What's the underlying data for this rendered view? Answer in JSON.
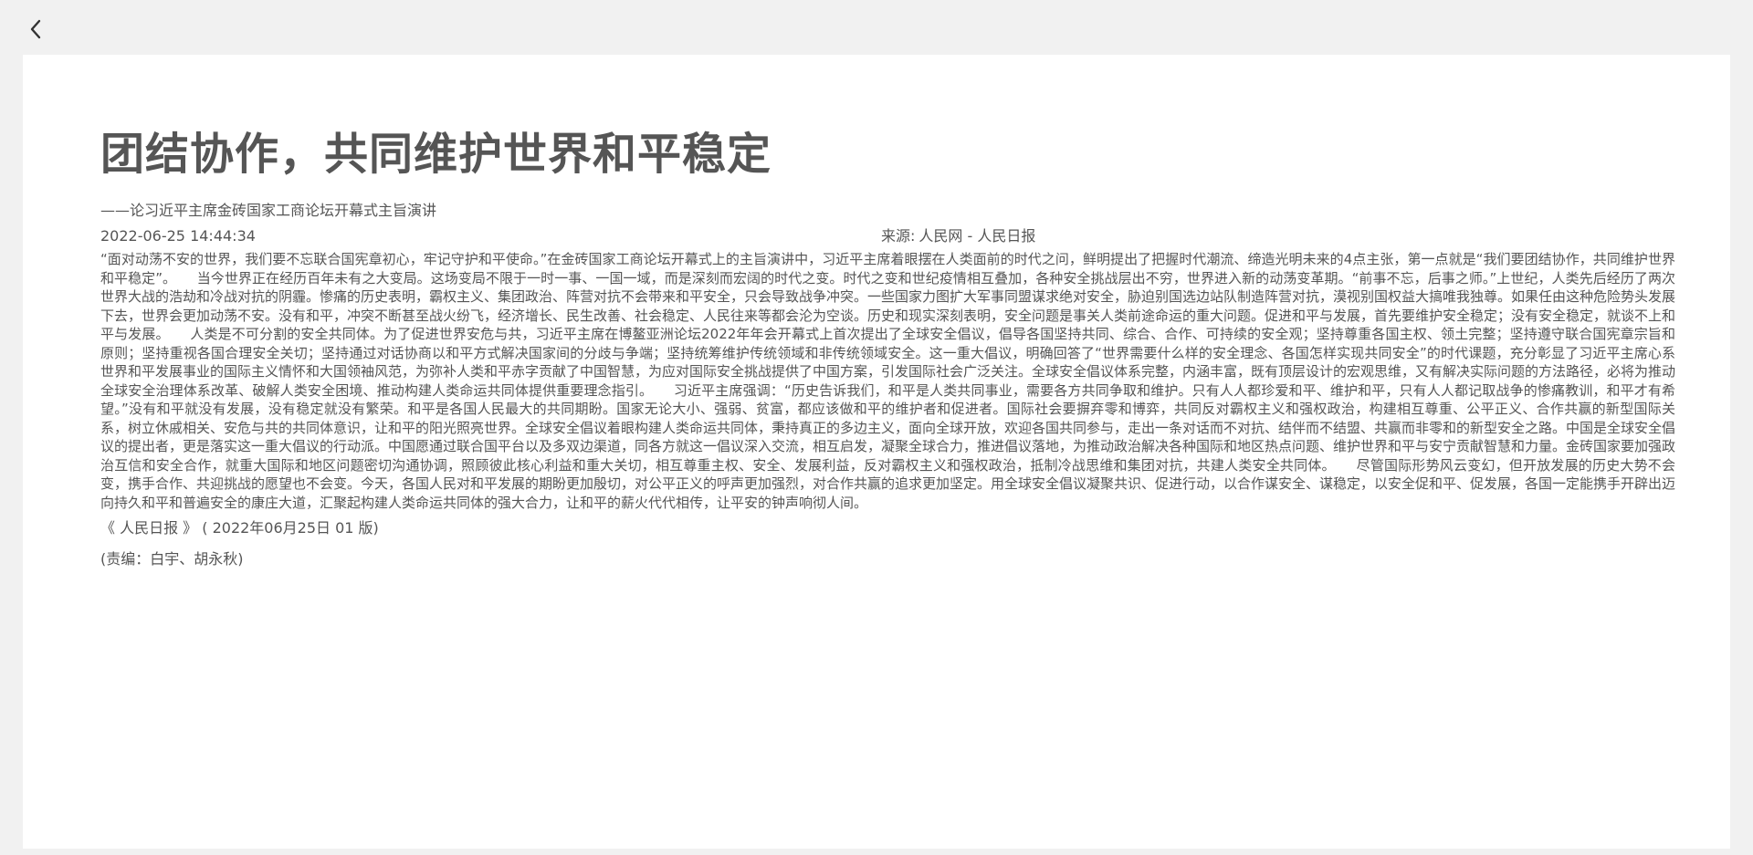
{
  "nav": {
    "back_icon": "chevron-left-icon"
  },
  "article": {
    "title": "团结协作，共同维护世界和平稳定",
    "subtitle": "——论习近平主席金砖国家工商论坛开幕式主旨演讲",
    "datetime": "2022-06-25 14:44:34",
    "source_label": "来源:",
    "source_value": "人民网 - 人民日报",
    "body": "“面对动荡不安的世界，我们要不忘联合国宪章初心，牢记守护和平使命。”在金砖国家工商论坛开幕式上的主旨演讲中，习近平主席着眼摆在人类面前的时代之问，鲜明提出了把握时代潮流、缔造光明未来的4点主张，第一点就是“我们要团结协作，共同维护世界和平稳定”。　　当今世界正在经历百年未有之大变局。这场变局不限于一时一事、一国一域，而是深刻而宏阔的时代之变。时代之变和世纪疫情相互叠加，各种安全挑战层出不穷，世界进入新的动荡变革期。“前事不忘，后事之师。”上世纪，人类先后经历了两次世界大战的浩劫和冷战对抗的阴霾。惨痛的历史表明，霸权主义、集团政治、阵营对抗不会带来和平安全，只会导致战争冲突。一些国家力图扩大军事同盟谋求绝对安全，胁迫别国选边站队制造阵营对抗，漠视别国权益大搞唯我独尊。如果任由这种危险势头发展下去，世界会更加动荡不安。没有和平，冲突不断甚至战火纷飞，经济增长、民生改善、社会稳定、人民往来等都会沦为空谈。历史和现实深刻表明，安全问题是事关人类前途命运的重大问题。促进和平与发展，首先要维护安全稳定；没有安全稳定，就谈不上和平与发展。　　人类是不可分割的安全共同体。为了促进世界安危与共，习近平主席在博鳌亚洲论坛2022年年会开幕式上首次提出了全球安全倡议，倡导各国坚持共同、综合、合作、可持续的安全观；坚持尊重各国主权、领土完整；坚持遵守联合国宪章宗旨和原则；坚持重视各国合理安全关切；坚持通过对话协商以和平方式解决国家间的分歧与争端；坚持统筹维护传统领域和非传统领域安全。这一重大倡议，明确回答了“世界需要什么样的安全理念、各国怎样实现共同安全”的时代课题，充分彰显了习近平主席心系世界和平发展事业的国际主义情怀和大国领袖风范，为弥补人类和平赤字贡献了中国智慧，为应对国际安全挑战提供了中国方案，引发国际社会广泛关注。全球安全倡议体系完整，内涵丰富，既有顶层设计的宏观思维，又有解决实际问题的方法路径，必将为推动全球安全治理体系改革、破解人类安全困境、推动构建人类命运共同体提供重要理念指引。　　习近平主席强调：“历史告诉我们，和平是人类共同事业，需要各方共同争取和维护。只有人人都珍爱和平、维护和平，只有人人都记取战争的惨痛教训，和平才有希望。”没有和平就没有发展，没有稳定就没有繁荣。和平是各国人民最大的共同期盼。国家无论大小、强弱、贫富，都应该做和平的维护者和促进者。国际社会要摒弃零和博弈，共同反对霸权主义和强权政治，构建相互尊重、公平正义、合作共赢的新型国际关系，树立休戚相关、安危与共的共同体意识，让和平的阳光照亮世界。全球安全倡议着眼构建人类命运共同体，秉持真正的多边主义，面向全球开放，欢迎各国共同参与，走出一条对话而不对抗、结伴而不结盟、共赢而非零和的新型安全之路。中国是全球安全倡议的提出者，更是落实这一重大倡议的行动派。中国愿通过联合国平台以及多双边渠道，同各方就这一倡议深入交流，相互启发，凝聚全球合力，推进倡议落地，为推动政治解决各种国际和地区热点问题、维护世界和平与安宁贡献智慧和力量。金砖国家要加强政治互信和安全合作，就重大国际和地区问题密切沟通协调，照顾彼此核心利益和重大关切，相互尊重主权、安全、发展利益，反对霸权主义和强权政治，抵制冷战思维和集团对抗，共建人类安全共同体。　　尽管国际形势风云变幻，但开放发展的历史大势不会变，携手合作、共迎挑战的愿望也不会变。今天，各国人民对和平发展的期盼更加殷切，对公平正义的呼声更加强烈，对合作共赢的追求更加坚定。用全球安全倡议凝聚共识、促进行动，以合作谋安全、谋稳定，以安全促和平、促发展，各国一定能携手开辟出迈向持久和平和普遍安全的康庄大道，汇聚起构建人类命运共同体的强大合力，让和平的薪火代代相传，让平安的钟声响彻人间。",
    "publication": "《 人民日报 》 ( 2022年06月25日 01 版)",
    "editor": "(责编：白宇、胡永秋)"
  }
}
